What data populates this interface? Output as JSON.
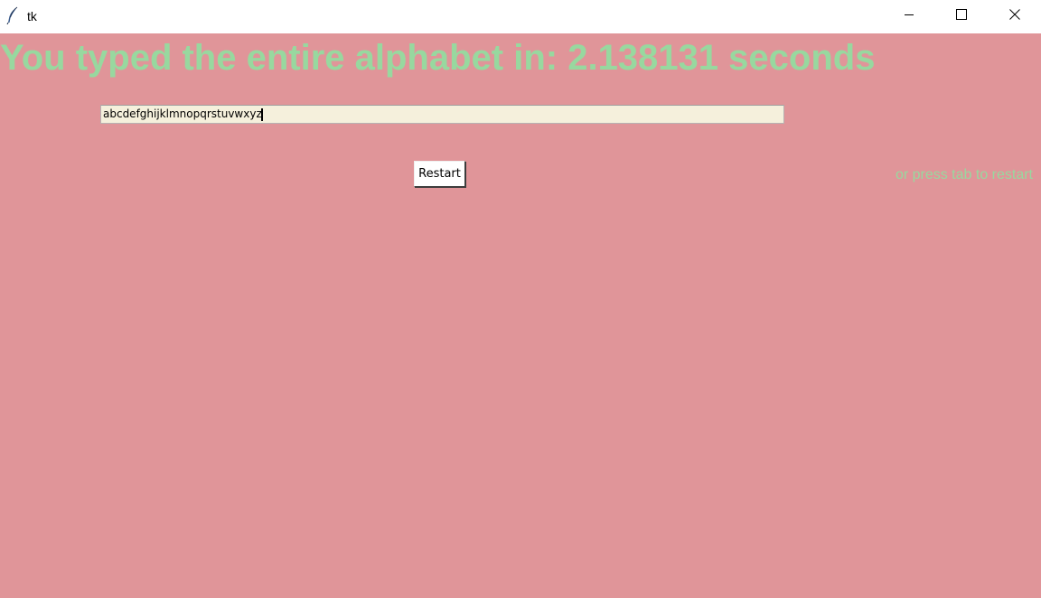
{
  "window": {
    "title": "tk",
    "app_icon": "feather-icon",
    "controls": {
      "minimize_icon": "minimize-icon",
      "maximize_icon": "maximize-icon",
      "close_icon": "close-icon"
    }
  },
  "main": {
    "headline": "You typed the entire alphabet in: 2.138131 seconds",
    "entry_value": "abcdefghijklmnopqrstuvwxyz",
    "restart_label": "Restart",
    "hint": "or press tab to restart"
  },
  "colors": {
    "background": "#e09599",
    "text_accent": "#98d89f",
    "entry_background": "#f5f0dc"
  }
}
